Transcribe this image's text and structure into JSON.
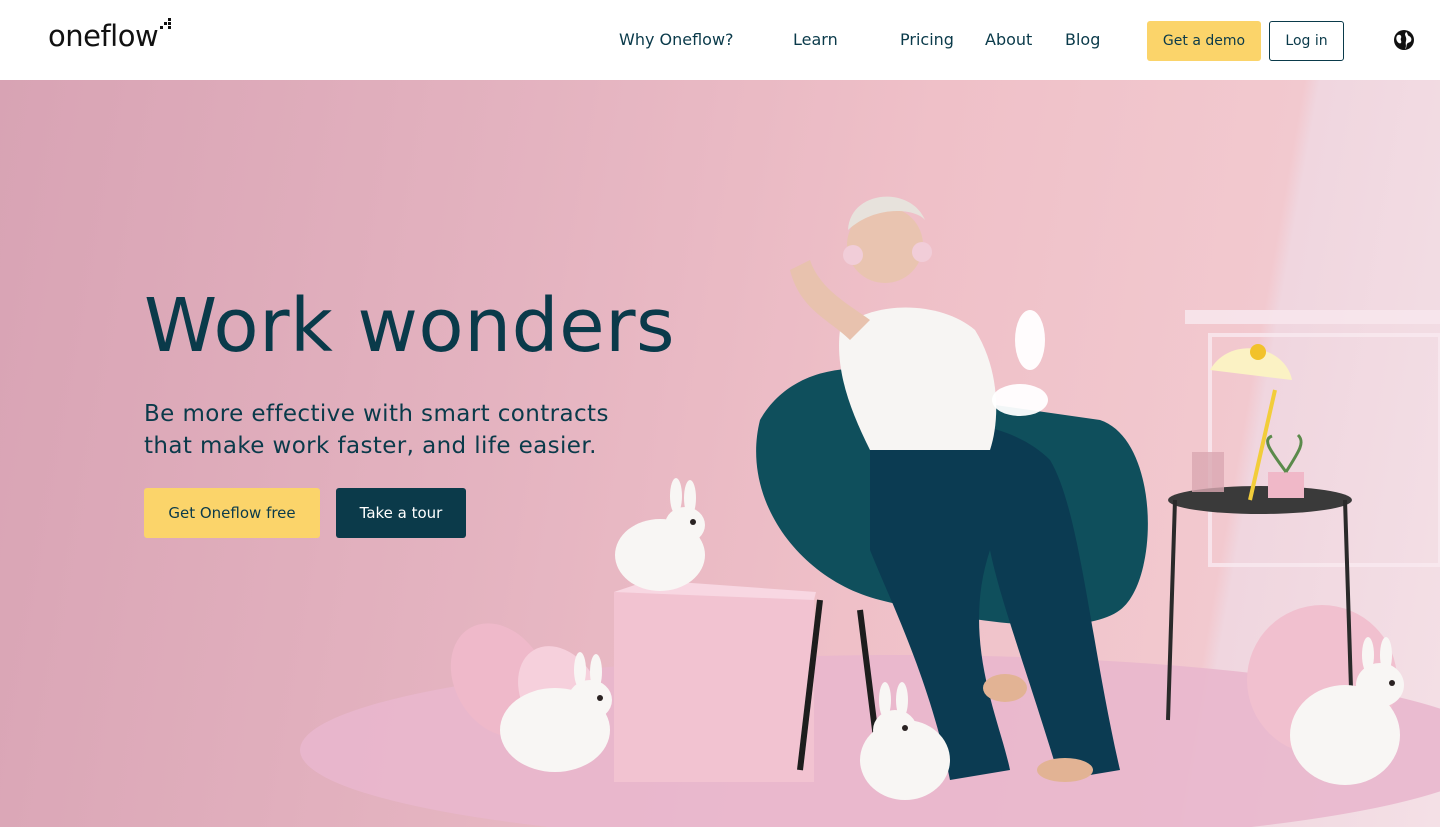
{
  "brand": {
    "name": "oneflow",
    "logo_icon": "pixel-dots-icon"
  },
  "nav": {
    "items": [
      {
        "label": "Why Oneflow?"
      },
      {
        "label": "Learn"
      },
      {
        "label": "Pricing"
      },
      {
        "label": "About"
      },
      {
        "label": "Blog"
      }
    ],
    "demo_label": "Get a demo",
    "login_label": "Log in",
    "language_icon": "globe-icon"
  },
  "hero": {
    "title": "Work wonders",
    "subtitle": "Be more effective with smart contracts that make work faster, and life easier.",
    "primary_cta": "Get Oneflow free",
    "secondary_cta": "Take a tour",
    "image": "photo-woman-in-teal-chair-with-rabbits"
  },
  "colors": {
    "accent_yellow": "#fbd46a",
    "dark_teal": "#0b3a4a",
    "hero_pink": "#e8b8c4",
    "text": "#0a3a4a"
  }
}
